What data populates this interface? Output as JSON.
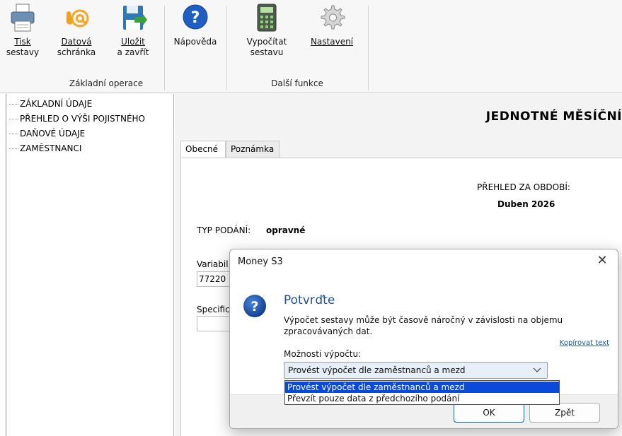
{
  "ribbon": {
    "buttons": [
      {
        "line1": "Tisk",
        "line2": "sestavy",
        "underline": "T"
      },
      {
        "line1": "Datová",
        "line2": "schránka",
        "underline": "D"
      },
      {
        "line1": "Uložit",
        "line2": "a zavřít",
        "underline": "U"
      },
      {
        "line1": "Nápověda",
        "line2": ""
      },
      {
        "line1": "Vypočítat",
        "line2": "sestavu"
      },
      {
        "line1": "Nastavení",
        "line2": "",
        "underline": "N"
      }
    ],
    "groups": [
      "Základní operace",
      "Další funkce"
    ],
    "icons": [
      "printer-icon",
      "email-at-icon",
      "save-icon",
      "help-icon",
      "calculator-icon",
      "gear-icon"
    ]
  },
  "tree": {
    "items": [
      "ZÁKLADNÍ ÚDAJE",
      "PŘEHLED O VÝŠI POJISTNÉHO",
      "DAŇOVÉ ÚDAJE",
      "ZAMĚSTNANCI"
    ]
  },
  "main": {
    "title": "JEDNOTNÉ MĚSÍČNÍ",
    "tabs": [
      "Obecné",
      "Poznámka"
    ],
    "period_label": "PŘEHLED ZA OBDOBÍ:",
    "period_value": "Duben 2026",
    "typ_label": "TYP PODÁNÍ:",
    "typ_value": "opravné",
    "variabil_label": "Variabil",
    "variabil_value": "77220",
    "specific_label": "Specific"
  },
  "dialog": {
    "title": "Money S3",
    "close": "✕",
    "heading": "Potvrďte",
    "message": "Výpočet sestavy může být časově náročný v závislosti na objemu zpracovávaných dat.",
    "copy_link": "Kopírovat text",
    "options_label": "Možnosti výpočtu:",
    "selected_option": "Provést výpočet dle zaměstnanců a mezd",
    "options": [
      "Provést výpočet dle zaměstnanců a mezd",
      "Převzít pouze data z předchozího podání"
    ],
    "ok": "OK",
    "back": "Zpět"
  },
  "colors": {
    "accent": "#0067c0",
    "dropdown_selection": "#0a4ad6",
    "heading": "#1f4e9a"
  }
}
